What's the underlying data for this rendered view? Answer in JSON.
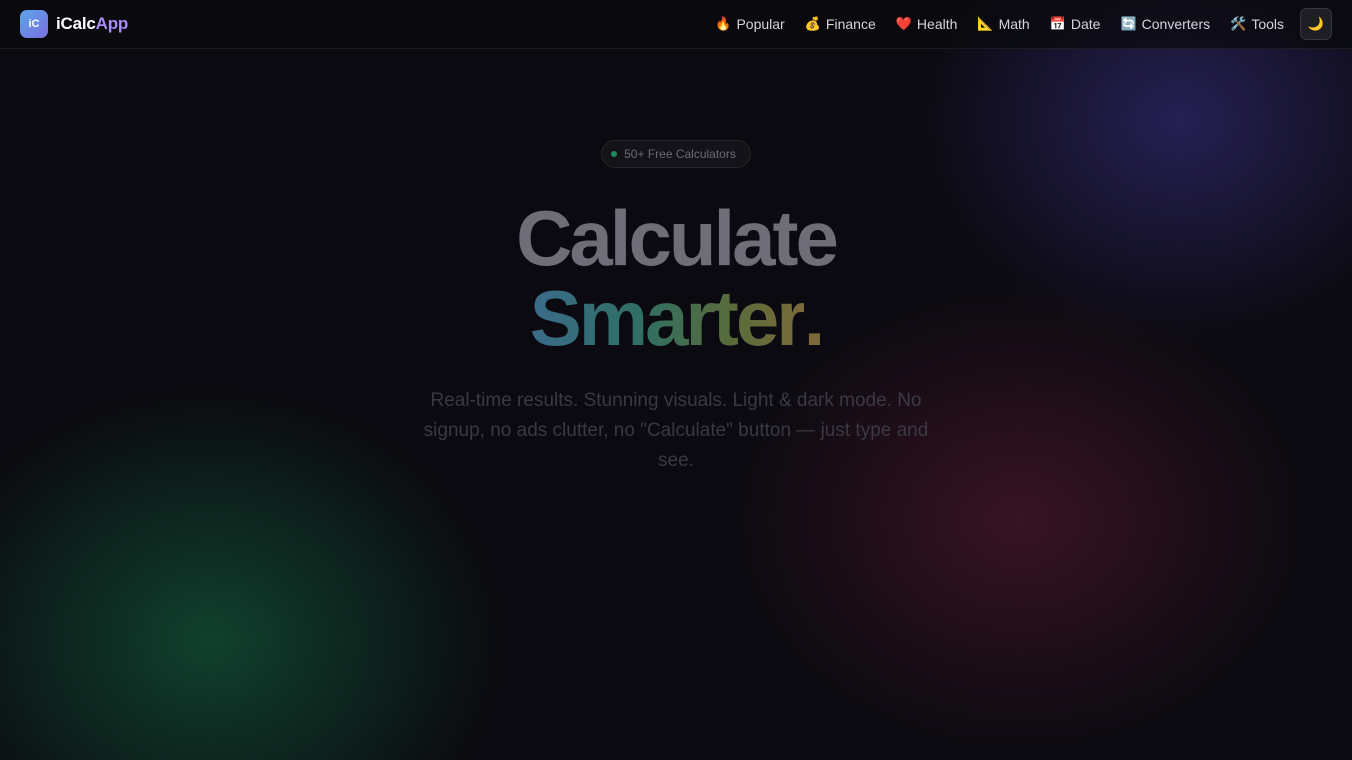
{
  "brand": {
    "badge": "iC",
    "name_main": "iCalc",
    "name_accent": "App"
  },
  "nav": {
    "items": [
      {
        "icon": "🔥",
        "label": "Popular",
        "icon_name": "fire-icon"
      },
      {
        "icon": "💰",
        "label": "Finance",
        "icon_name": "money-bag-icon"
      },
      {
        "icon": "❤️",
        "label": "Health",
        "icon_name": "heart-icon"
      },
      {
        "icon": "📐",
        "label": "Math",
        "icon_name": "triangle-ruler-icon"
      },
      {
        "icon": "📅",
        "label": "Date",
        "icon_name": "calendar-icon"
      },
      {
        "icon": "🔄",
        "label": "Converters",
        "icon_name": "arrows-cycle-icon"
      },
      {
        "icon": "🛠️",
        "label": "Tools",
        "icon_name": "tools-icon"
      }
    ],
    "theme_toggle_icon": "🌙"
  },
  "hero": {
    "badge": "50+ Free Calculators",
    "title_line1": "Calculate",
    "title_line2": "Smarter",
    "title_period": ".",
    "subtitle": "Real-time results. Stunning visuals. Light & dark mode. No signup, no ads clutter, no \"Calculate\" button — just type and see."
  },
  "colors": {
    "background": "#0b0a10",
    "brand_accent": "#a98cf5",
    "badge_dot": "#1f8a5a"
  }
}
